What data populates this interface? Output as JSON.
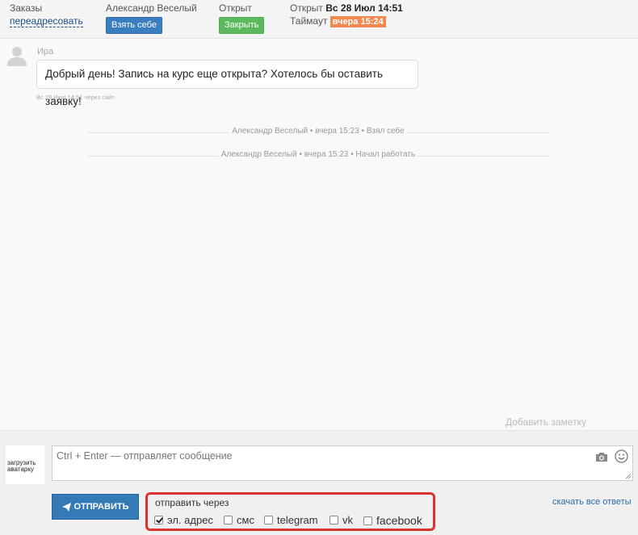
{
  "header": {
    "orders_label": "Заказы",
    "redirect_link": "переадресовать",
    "agent_name": "Александр Веселый",
    "take_button": "Взять себе",
    "status_label": "Открыт",
    "close_button": "Закрыть",
    "opened_label": "Открыт",
    "opened_value": "Вс 28 Июл 14:51",
    "timeout_label": "Таймаут",
    "timeout_value": "вчера 15:24"
  },
  "message": {
    "author": "Ира",
    "text": "Добрый день! Запись на курс еще открыта? Хотелось бы оставить заявку!",
    "meta": "Вс 28 Июл 14:51 через сайт"
  },
  "events": [
    "Александр Веселый • вчера 15:23 • Взял себе",
    "Александр Веселый • вчера 15:23 • Начал работать"
  ],
  "add_note": "Добавить заметку",
  "composer": {
    "avatar_upload": "загрузить аватарку",
    "placeholder": "Ctrl + Enter — отправляет сообщение",
    "send_button": "ОТПРАВИТЬ",
    "send_via_label": "отправить через",
    "channels": [
      {
        "label": "эл. адрес",
        "checked": true
      },
      {
        "label": "смс",
        "checked": false
      },
      {
        "label": "telegram",
        "checked": false
      },
      {
        "label": "vk",
        "checked": false
      },
      {
        "label": "facebook",
        "checked": false
      }
    ],
    "download_link": "скачать все ответы"
  },
  "icons": [
    "user-icon",
    "camera-icon",
    "smile-icon",
    "paper-plane-icon",
    "resize-icon"
  ],
  "colors": {
    "primary": "#337ab7",
    "success": "#5cb85c",
    "timeout": "#f0884f",
    "highlight_border": "#d9332e"
  }
}
